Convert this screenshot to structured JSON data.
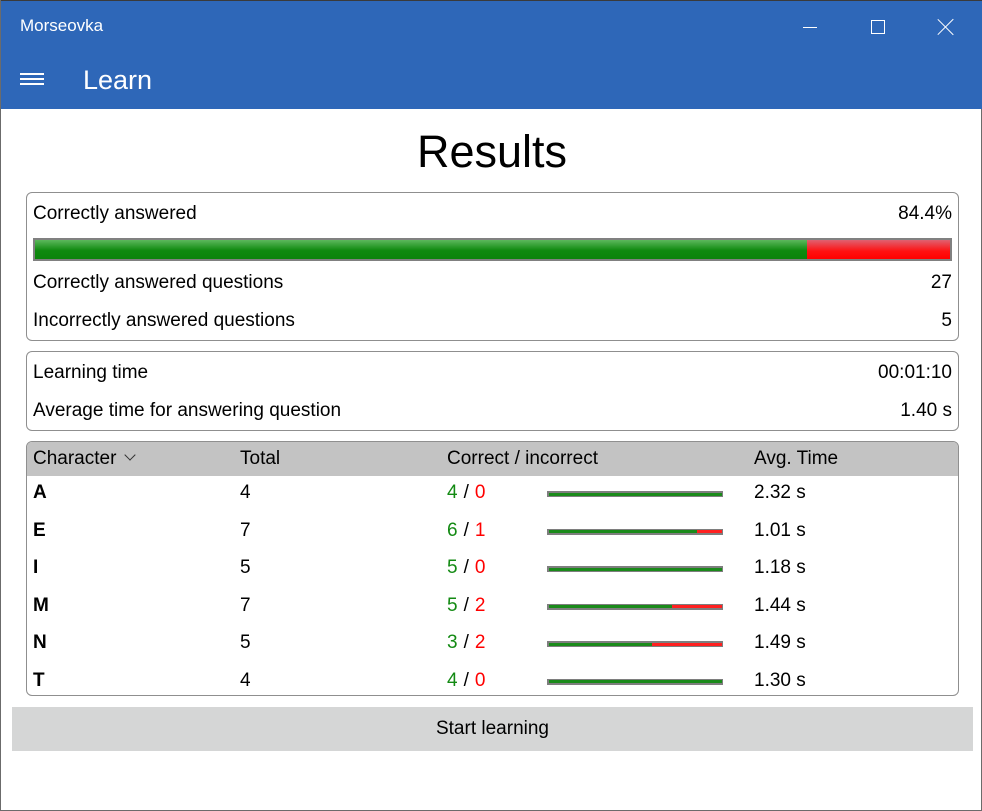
{
  "window": {
    "app_title": "Morseovka",
    "controls": {
      "minimize": "minimize-icon",
      "maximize": "maximize-icon",
      "close": "close-icon"
    }
  },
  "appbar": {
    "menu_icon": "hamburger-menu-icon",
    "title": "Learn"
  },
  "results": {
    "title": "Results",
    "summary": {
      "correct_label": "Correctly answered",
      "correct_percent_text": "84.4%",
      "correct_fraction": 0.844,
      "correct_questions_label": "Correctly answered questions",
      "correct_questions": "27",
      "incorrect_questions_label": "Incorrectly answered questions",
      "incorrect_questions": "5"
    },
    "time": {
      "learning_time_label": "Learning time",
      "learning_time": "00:01:10",
      "avg_time_label": "Average time for answering question",
      "avg_time": "1.40 s"
    },
    "table": {
      "headers": {
        "character": "Character",
        "total": "Total",
        "correct_incorrect": "Correct / incorrect",
        "avg_time": "Avg. Time"
      },
      "sort_icon": "chevron-down-icon",
      "separator": "/",
      "rows": [
        {
          "character": "A",
          "total": "4",
          "correct": "4",
          "incorrect": "0",
          "avg_time": "2.32 s"
        },
        {
          "character": "E",
          "total": "7",
          "correct": "6",
          "incorrect": "1",
          "avg_time": "1.01 s"
        },
        {
          "character": "I",
          "total": "5",
          "correct": "5",
          "incorrect": "0",
          "avg_time": "1.18 s"
        },
        {
          "character": "M",
          "total": "7",
          "correct": "5",
          "incorrect": "2",
          "avg_time": "1.44 s"
        },
        {
          "character": "N",
          "total": "5",
          "correct": "3",
          "incorrect": "2",
          "avg_time": "1.49 s"
        },
        {
          "character": "T",
          "total": "4",
          "correct": "4",
          "incorrect": "0",
          "avg_time": "1.30 s"
        }
      ]
    }
  },
  "start_button_label": "Start learning",
  "colors": {
    "accent": "#2e67b8",
    "correct": "#138a13",
    "incorrect": "#ff0000",
    "header_bg": "#c3c3c3",
    "button_bg": "#d5d6d6"
  }
}
